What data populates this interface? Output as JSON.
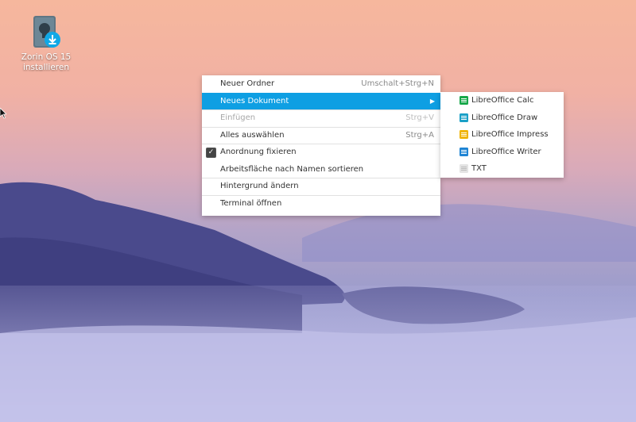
{
  "desktop": {
    "icon_label_line1": "Zorin OS 15",
    "icon_label_line2": "installieren"
  },
  "context_menu": {
    "items": [
      {
        "label": "Neuer Ordner",
        "shortcut": "Umschalt+Strg+N"
      },
      {
        "label": "Neues Dokument"
      },
      {
        "label": "Einfügen",
        "shortcut": "Strg+V"
      },
      {
        "label": "Alles auswählen",
        "shortcut": "Strg+A"
      },
      {
        "label": "Anordnung fixieren"
      },
      {
        "label": "Arbeitsfläche nach Namen sortieren"
      },
      {
        "label": "Hintergrund ändern"
      },
      {
        "label": "Terminal öffnen"
      }
    ]
  },
  "submenu": {
    "items": [
      {
        "label": "LibreOffice Calc",
        "icon": "calc-icon"
      },
      {
        "label": "LibreOffice Draw",
        "icon": "draw-icon"
      },
      {
        "label": "LibreOffice Impress",
        "icon": "impress-icon"
      },
      {
        "label": "LibreOffice Writer",
        "icon": "writer-icon"
      },
      {
        "label": "TXT",
        "icon": "text-file-icon"
      }
    ]
  },
  "colors": {
    "highlight": "#0e9fe3",
    "menu_background": "#ffffff"
  }
}
